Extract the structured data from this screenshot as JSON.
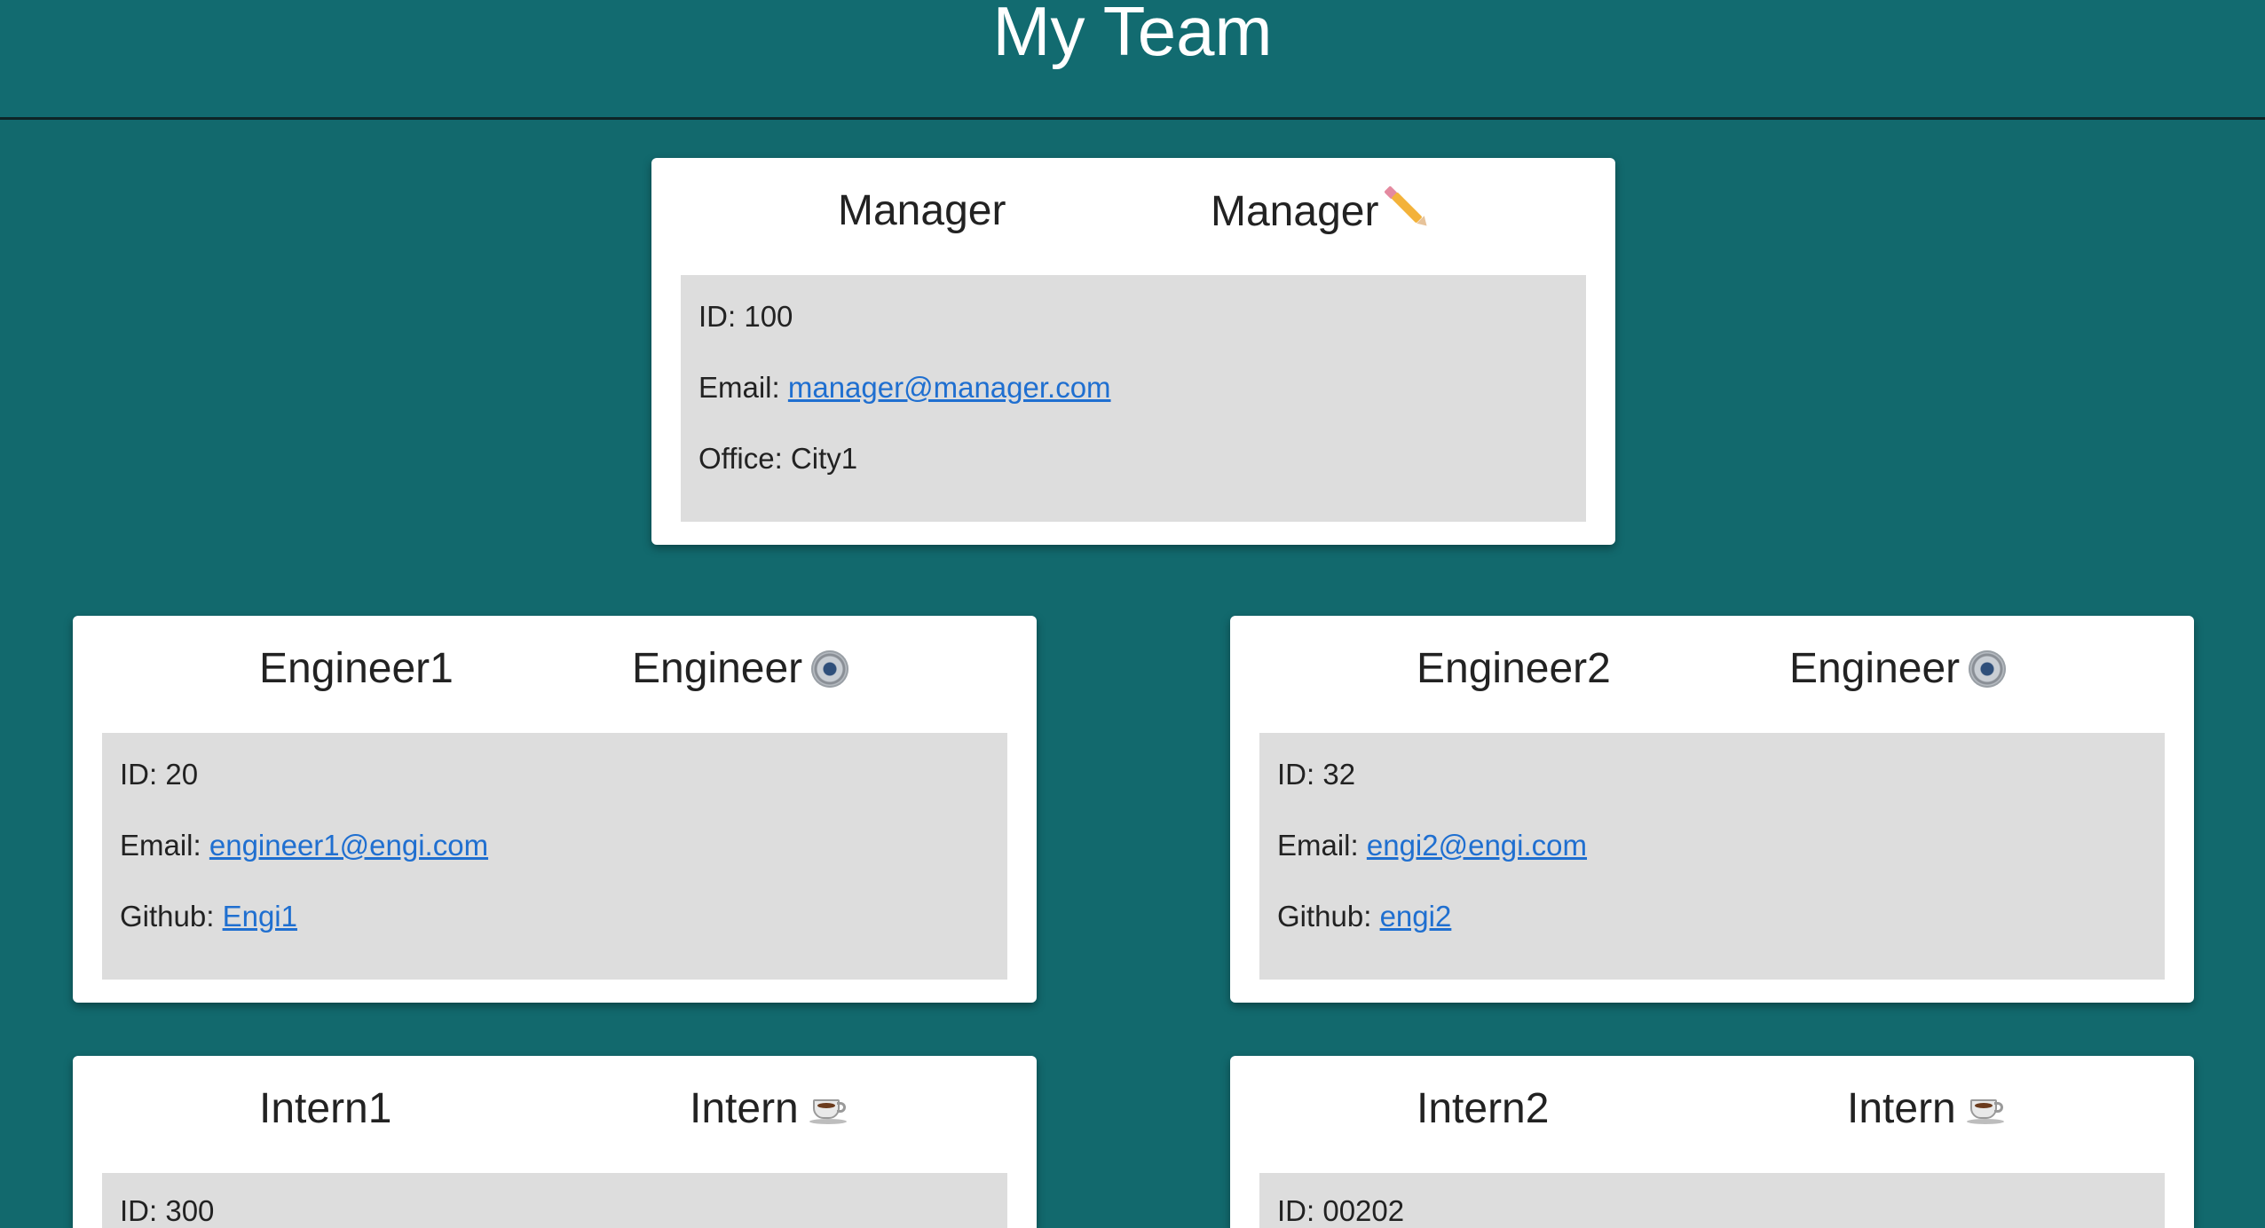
{
  "header": {
    "title": "My Team"
  },
  "manager": {
    "name": "Manager",
    "role": "Manager",
    "role_icon": "pencil-icon",
    "id_label": "ID: 100",
    "email_prefix": "Email: ",
    "email": "manager@manager.com",
    "office_label": "Office: City1"
  },
  "engineer1": {
    "name": "Engineer1",
    "role": "Engineer",
    "role_icon": "gear-icon",
    "id_label": "ID: 20",
    "email_prefix": "Email: ",
    "email": "engineer1@engi.com",
    "github_prefix": "Github: ",
    "github": "Engi1"
  },
  "engineer2": {
    "name": "Engineer2",
    "role": "Engineer",
    "role_icon": "gear-icon",
    "id_label": "ID: 32",
    "email_prefix": "Email: ",
    "email": "engi2@engi.com",
    "github_prefix": "Github: ",
    "github": "engi2"
  },
  "intern1": {
    "name": "Intern1",
    "role": "Intern",
    "role_icon": "coffee-icon",
    "id_label": "ID: 300"
  },
  "intern2": {
    "name": "Intern2",
    "role": "Intern",
    "role_icon": "coffee-icon",
    "id_label": "ID: 00202"
  },
  "colors": {
    "background": "#12696d",
    "card": "#ffffff",
    "card_body": "#dddddd",
    "link": "#1f6fd0"
  }
}
